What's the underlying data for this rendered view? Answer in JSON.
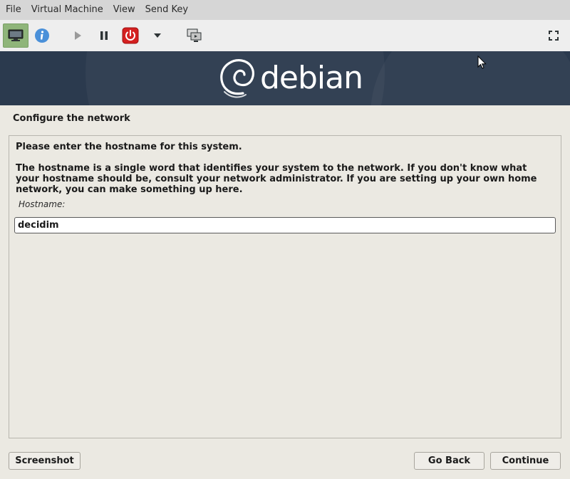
{
  "menubar": {
    "items": [
      "File",
      "Virtual Machine",
      "View",
      "Send Key"
    ]
  },
  "toolbar": {
    "console_icon": "monitor-icon",
    "info_icon": "info-icon",
    "play_icon": "play-icon",
    "pause_icon": "pause-icon",
    "power_icon": "power-icon",
    "dropdown_icon": "caret-down-icon",
    "screens_icon": "screens-icon",
    "fullscreen_icon": "fullscreen-icon",
    "colors": {
      "console_bg": "#8fb57a",
      "info": "#4a90d9",
      "power": "#d42020"
    }
  },
  "banner": {
    "logo_text": "debian",
    "bg_color": "#2b3a4e"
  },
  "page": {
    "title": "Configure the network",
    "prompt": "Please enter the hostname for this system.",
    "description": "The hostname is a single word that identifies your system to the network. If you don't know what your hostname should be, consult your network administrator. If you are setting up your own home network, you can make something up here.",
    "field_label": "Hostname:",
    "hostname_value": "decidim"
  },
  "buttons": {
    "screenshot": "Screenshot",
    "go_back": "Go Back",
    "continue": "Continue"
  }
}
